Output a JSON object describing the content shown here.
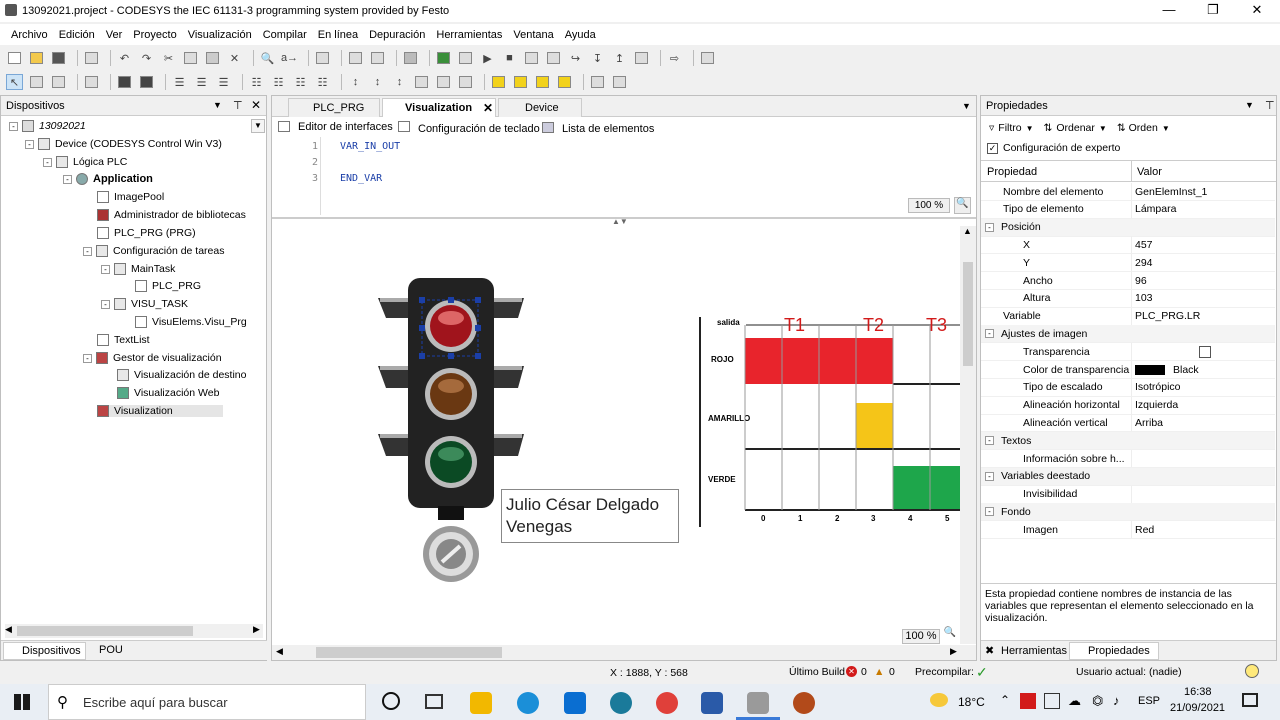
{
  "window": {
    "title": "13092021.project - CODESYS the IEC 61131-3 programming system provided by Festo"
  },
  "menu": [
    "Archivo",
    "Edición",
    "Ver",
    "Proyecto",
    "Visualización",
    "Compilar",
    "En línea",
    "Depuración",
    "Herramientas",
    "Ventana",
    "Ayuda"
  ],
  "devices": {
    "title": "Dispositivos",
    "tree": [
      {
        "label": "13092021",
        "italic": true
      },
      {
        "label": "Device (CODESYS Control Win V3)"
      },
      {
        "label": "Lógica PLC"
      },
      {
        "label": "Application",
        "bold": true
      },
      {
        "label": "ImagePool"
      },
      {
        "label": "Administrador de bibliotecas"
      },
      {
        "label": "PLC_PRG (PRG)"
      },
      {
        "label": "Configuración de tareas"
      },
      {
        "label": "MainTask"
      },
      {
        "label": "PLC_PRG"
      },
      {
        "label": "VISU_TASK"
      },
      {
        "label": "VisuElems.Visu_Prg"
      },
      {
        "label": "TextList"
      },
      {
        "label": "Gestor de visualización"
      },
      {
        "label": "Visualización de destino"
      },
      {
        "label": "Visualización Web"
      },
      {
        "label": "Visualization"
      }
    ],
    "bottom_tabs": [
      "Dispositivos",
      "POU"
    ]
  },
  "editor": {
    "tabs": [
      "PLC_PRG",
      "Visualization",
      "Device"
    ],
    "subtabs": [
      "Editor de interfaces",
      "Configuración de teclado",
      "Lista de elementos"
    ],
    "code": [
      {
        "n": "1",
        "t": "VAR_IN_OUT"
      },
      {
        "n": "2",
        "t": ""
      },
      {
        "n": "3",
        "t": "END_VAR"
      }
    ],
    "zoom_top": "100 %",
    "zoom_bottom": "100 %",
    "name_box": "Julio César Delgado\nVenegas",
    "name_line1": "Julio César Delgado",
    "name_line2": "Venegas"
  },
  "timing": {
    "header": "salida",
    "markers": [
      "T1",
      "T2",
      "T3"
    ],
    "rows": [
      "ROJO",
      "AMARILLO",
      "VERDE"
    ],
    "axis": [
      "0",
      "1",
      "2",
      "3",
      "4",
      "5"
    ],
    "colors": {
      "red": "#e8242c",
      "yellow": "#f5c518",
      "green": "#1ea64b"
    }
  },
  "properties": {
    "title": "Propiedades",
    "toolbar": [
      "Filtro",
      "Ordenar",
      "Orden"
    ],
    "expert": "Configuración de experto",
    "col_prop": "Propiedad",
    "col_val": "Valor",
    "rows": [
      {
        "n": "Nombre del elemento",
        "v": "GenElemInst_1",
        "lvl": 1
      },
      {
        "n": "Tipo de elemento",
        "v": "Lámpara",
        "lvl": 1
      },
      {
        "n": "Posición",
        "v": "",
        "lvl": 0,
        "cat": true
      },
      {
        "n": "X",
        "v": "457",
        "lvl": 2
      },
      {
        "n": "Y",
        "v": "294",
        "lvl": 2
      },
      {
        "n": "Ancho",
        "v": "96",
        "lvl": 2
      },
      {
        "n": "Altura",
        "v": "103",
        "lvl": 2
      },
      {
        "n": "Variable",
        "v": "PLC_PRG.LR",
        "lvl": 1
      },
      {
        "n": "Ajustes de imagen",
        "v": "",
        "lvl": 0,
        "cat": true
      },
      {
        "n": "Transparencia",
        "v": "",
        "lvl": 2,
        "check": true
      },
      {
        "n": "Color de transparencia",
        "v": "Black",
        "lvl": 2,
        "swatch": true
      },
      {
        "n": "Tipo de escalado",
        "v": "Isotrópico",
        "lvl": 2
      },
      {
        "n": "Alineación horizontal",
        "v": "Izquierda",
        "lvl": 2
      },
      {
        "n": "Alineación vertical",
        "v": "Arriba",
        "lvl": 2
      },
      {
        "n": "Textos",
        "v": "",
        "lvl": 0,
        "cat": true
      },
      {
        "n": "Información sobre h...",
        "v": "",
        "lvl": 2
      },
      {
        "n": "Variables deestado",
        "v": "",
        "lvl": 0,
        "cat": true
      },
      {
        "n": "Invisibilidad",
        "v": "",
        "lvl": 2
      },
      {
        "n": "Fondo",
        "v": "",
        "lvl": 0,
        "cat": true
      },
      {
        "n": "Imagen",
        "v": "Red",
        "lvl": 2
      }
    ],
    "description": "Esta propiedad contiene nombres de instancia de las variables que representan el elemento seleccionado en la visualización.",
    "bottom_tabs": [
      "Herramientas",
      "Propiedades"
    ]
  },
  "status": {
    "coords": "X : 1888, Y : 568",
    "build": "Último Build",
    "errors": "0",
    "warnings": "0",
    "precompile": "Precompilar:",
    "user": "Usuario actual: (nadie)"
  },
  "taskbar": {
    "search": "Escribe aquí para buscar",
    "temp": "18°C",
    "lang": "ESP",
    "time": "16:38",
    "date": "21/09/2021"
  }
}
